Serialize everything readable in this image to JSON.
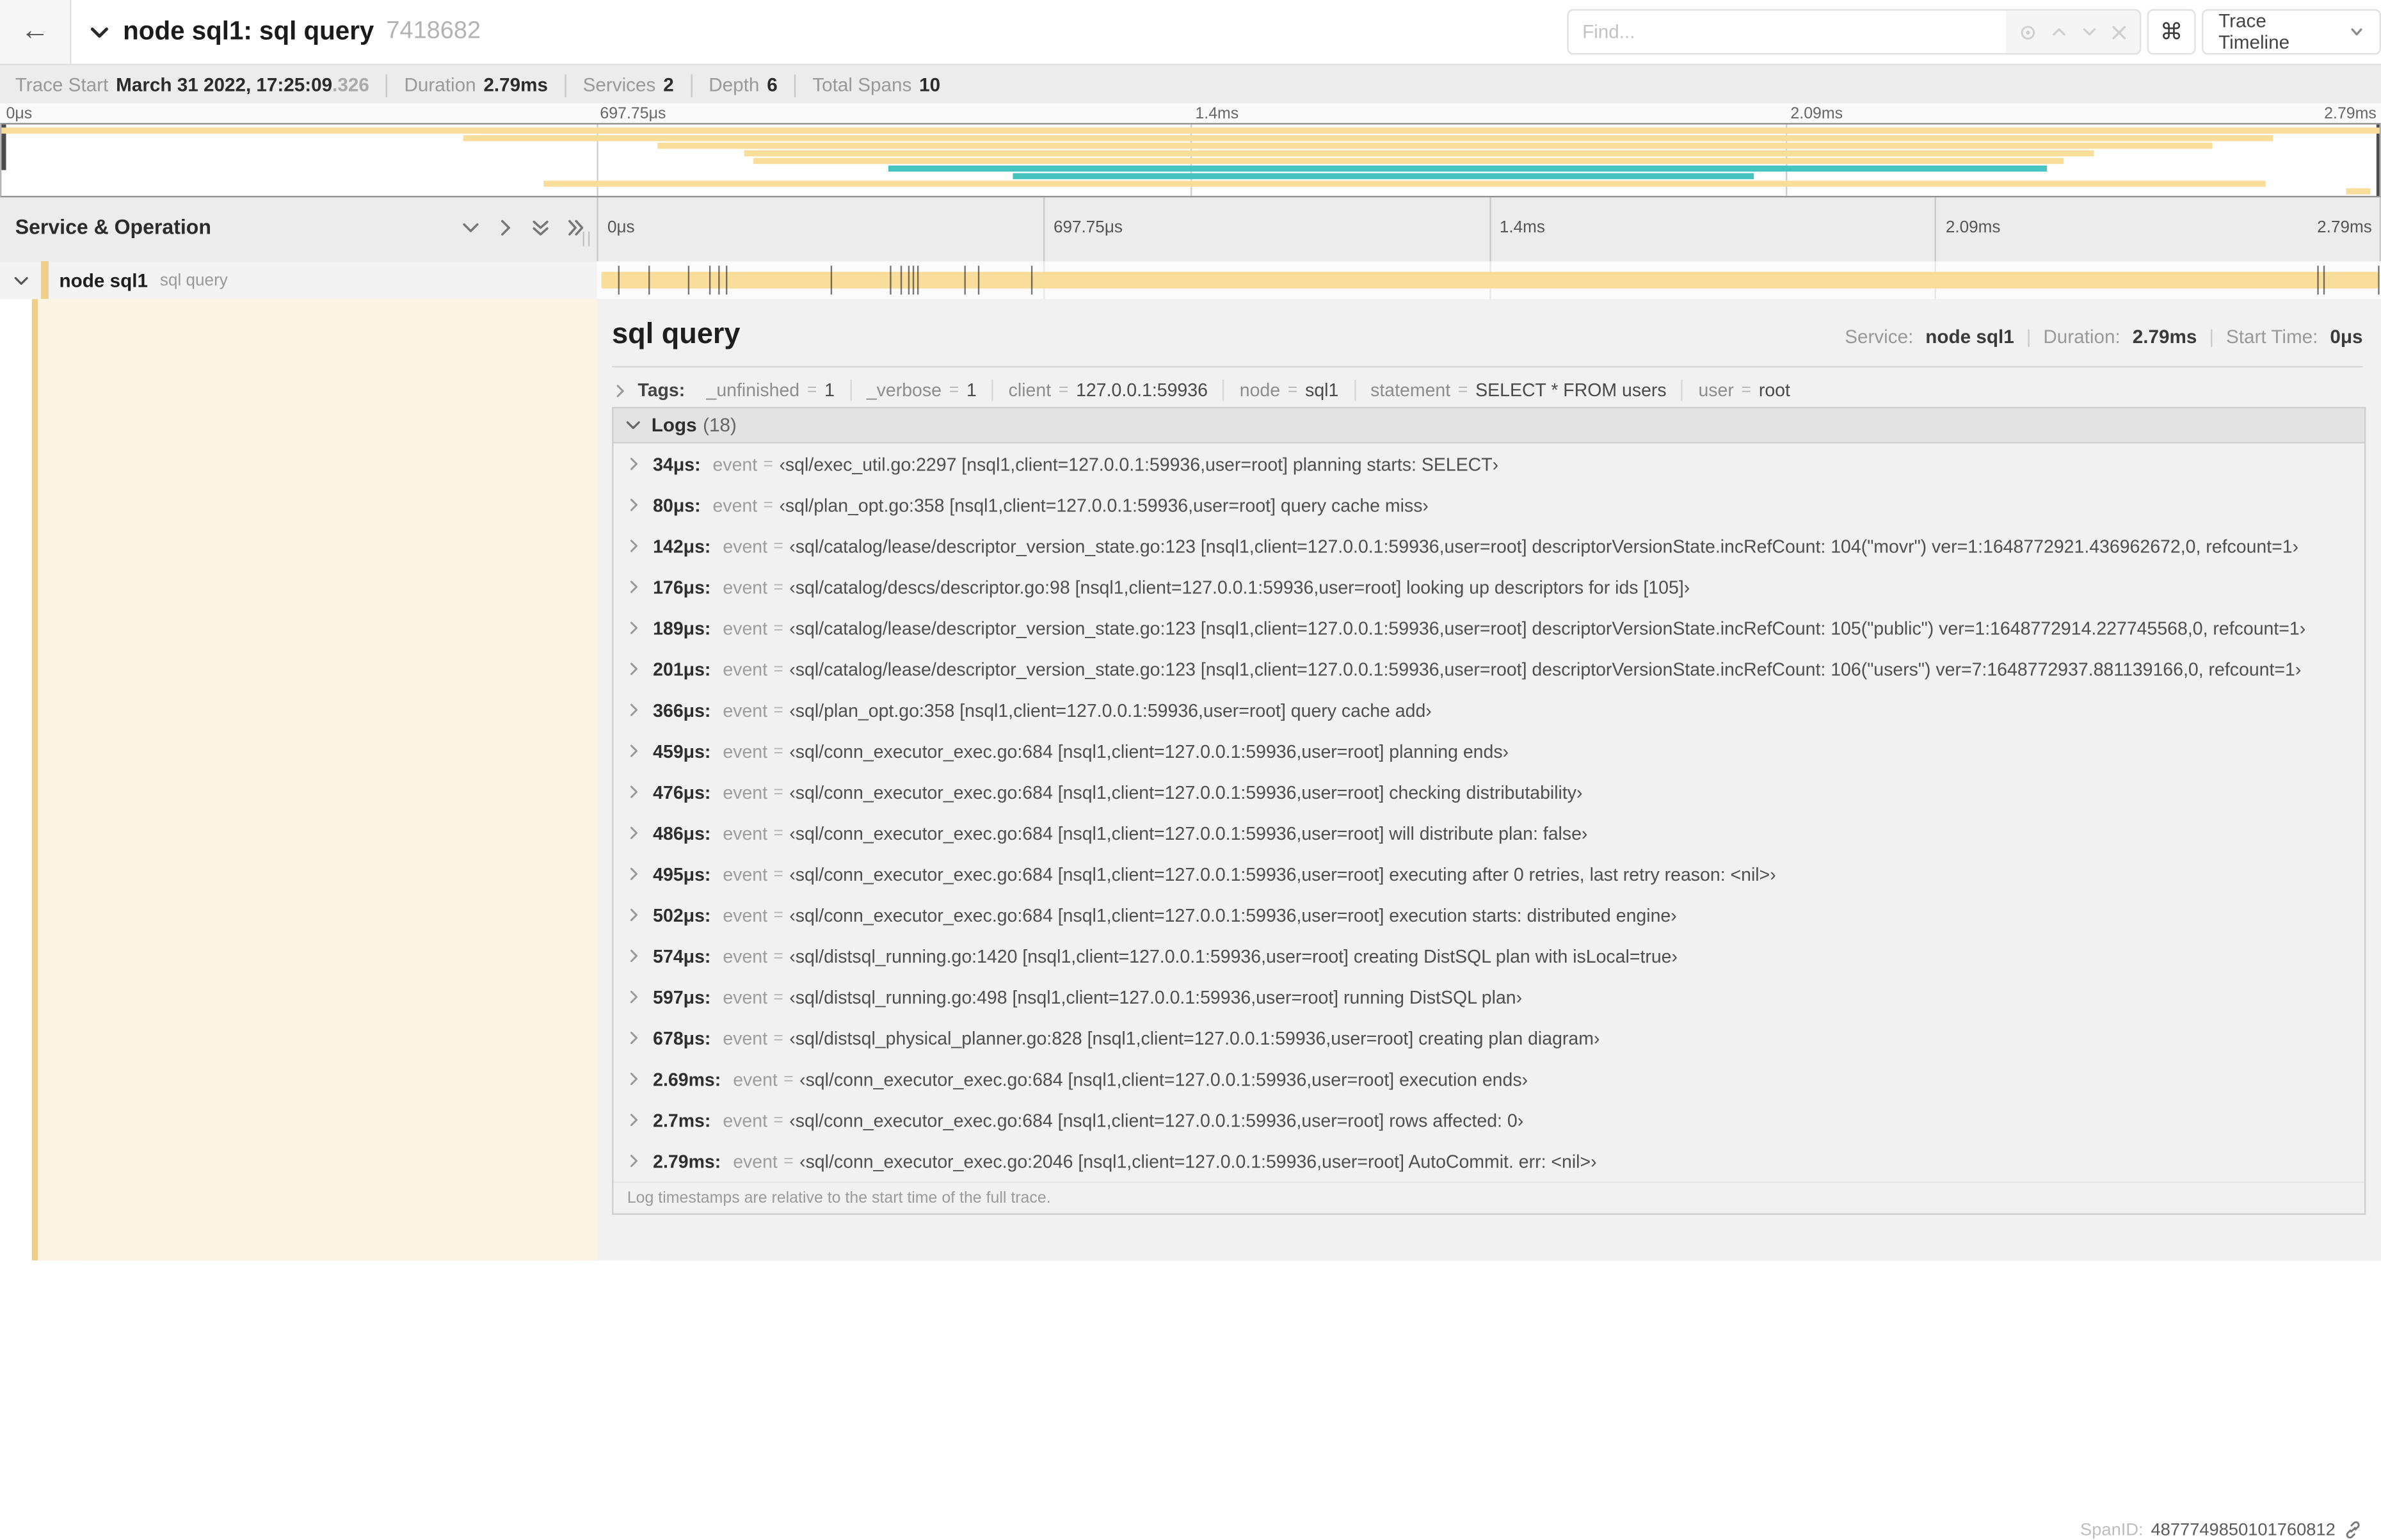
{
  "colors": {
    "orange": "#F8DD9B",
    "teal": "#47C4C0",
    "strip": "#F0CE8B",
    "cream": "#FCF4E3"
  },
  "header": {
    "title": "node sql1: sql query",
    "trace_id": "7418682",
    "find_placeholder": "Find...",
    "shortcut_key": "⌘",
    "view_selector": "Trace Timeline"
  },
  "summary": {
    "items": [
      {
        "label": "Trace Start",
        "value": "March 31 2022, 17:25:09",
        "suffix": ".326"
      },
      {
        "label": "Duration",
        "value": "2.79ms",
        "suffix": ""
      },
      {
        "label": "Services",
        "value": "2",
        "suffix": ""
      },
      {
        "label": "Depth",
        "value": "6",
        "suffix": ""
      },
      {
        "label": "Total Spans",
        "value": "10",
        "suffix": ""
      }
    ]
  },
  "ticks": [
    "0μs",
    "697.75μs",
    "1.4ms",
    "2.09ms",
    "2.79ms"
  ],
  "minimap": {
    "bars": [
      {
        "left": 0,
        "width": 100,
        "color": "orange"
      },
      {
        "left": 19.4,
        "width": 76.1,
        "color": "orange"
      },
      {
        "left": 27.6,
        "width": 65.4,
        "color": "orange"
      },
      {
        "left": 31.2,
        "width": 56.8,
        "color": "orange"
      },
      {
        "left": 31.6,
        "width": 55.1,
        "color": "orange"
      },
      {
        "left": 37.3,
        "width": 48.7,
        "color": "teal"
      },
      {
        "left": 42.5,
        "width": 31.2,
        "color": "teal"
      },
      {
        "left": 22.8,
        "width": 72.4,
        "color": "orange"
      },
      {
        "left": 98.6,
        "width": 1.0,
        "color": "orange"
      }
    ]
  },
  "timeline": {
    "column_header": "Service & Operation",
    "resizer_glyph": "||",
    "row": {
      "service": "node sql1",
      "operation": "sql query"
    },
    "markers_pct": [
      1.22,
      2.87,
      5.09,
      6.31,
      6.77,
      7.2,
      13.12,
      16.45,
      17.06,
      17.42,
      17.74,
      17.99,
      20.57,
      21.4,
      24.3,
      96.42,
      96.77,
      99.8
    ]
  },
  "detail": {
    "title": "sql query",
    "service_label": "Service:",
    "service": "node sql1",
    "duration_label": "Duration:",
    "duration": "2.79ms",
    "start_label": "Start Time:",
    "start": "0μs",
    "sep": "|",
    "tags": {
      "label": "Tags:",
      "eq": "=",
      "items": [
        {
          "key": "_unfinished",
          "value": "1"
        },
        {
          "key": "_verbose",
          "value": "1"
        },
        {
          "key": "client",
          "value": "127.0.0.1:59936"
        },
        {
          "key": "node",
          "value": "sql1"
        },
        {
          "key": "statement",
          "value": "SELECT * FROM users"
        },
        {
          "key": "user",
          "value": "root"
        }
      ]
    },
    "logs": {
      "label": "Logs",
      "count": "(18)",
      "eq": "=",
      "key": "event",
      "rows": [
        {
          "time": "34μs:",
          "value": "‹sql/exec_util.go:2297 [nsql1,client=127.0.0.1:59936,user=root] planning starts: SELECT›"
        },
        {
          "time": "80μs:",
          "value": "‹sql/plan_opt.go:358 [nsql1,client=127.0.0.1:59936,user=root] query cache miss›"
        },
        {
          "time": "142μs:",
          "value": "‹sql/catalog/lease/descriptor_version_state.go:123 [nsql1,client=127.0.0.1:59936,user=root] descriptorVersionState.incRefCount: 104(\"movr\") ver=1:1648772921.436962672,0, refcount=1›"
        },
        {
          "time": "176μs:",
          "value": "‹sql/catalog/descs/descriptor.go:98 [nsql1,client=127.0.0.1:59936,user=root] looking up descriptors for ids [105]›"
        },
        {
          "time": "189μs:",
          "value": "‹sql/catalog/lease/descriptor_version_state.go:123 [nsql1,client=127.0.0.1:59936,user=root] descriptorVersionState.incRefCount: 105(\"public\") ver=1:1648772914.227745568,0, refcount=1›"
        },
        {
          "time": "201μs:",
          "value": "‹sql/catalog/lease/descriptor_version_state.go:123 [nsql1,client=127.0.0.1:59936,user=root] descriptorVersionState.incRefCount: 106(\"users\") ver=7:1648772937.881139166,0, refcount=1›"
        },
        {
          "time": "366μs:",
          "value": "‹sql/plan_opt.go:358 [nsql1,client=127.0.0.1:59936,user=root] query cache add›"
        },
        {
          "time": "459μs:",
          "value": "‹sql/conn_executor_exec.go:684 [nsql1,client=127.0.0.1:59936,user=root] planning ends›"
        },
        {
          "time": "476μs:",
          "value": "‹sql/conn_executor_exec.go:684 [nsql1,client=127.0.0.1:59936,user=root] checking distributability›"
        },
        {
          "time": "486μs:",
          "value": "‹sql/conn_executor_exec.go:684 [nsql1,client=127.0.0.1:59936,user=root] will distribute plan: false›"
        },
        {
          "time": "495μs:",
          "value": "‹sql/conn_executor_exec.go:684 [nsql1,client=127.0.0.1:59936,user=root] executing after 0 retries, last retry reason: <nil>›"
        },
        {
          "time": "502μs:",
          "value": "‹sql/conn_executor_exec.go:684 [nsql1,client=127.0.0.1:59936,user=root] execution starts: distributed engine›"
        },
        {
          "time": "574μs:",
          "value": "‹sql/distsql_running.go:1420 [nsql1,client=127.0.0.1:59936,user=root] creating DistSQL plan with isLocal=true›"
        },
        {
          "time": "597μs:",
          "value": "‹sql/distsql_running.go:498 [nsql1,client=127.0.0.1:59936,user=root] running DistSQL plan›"
        },
        {
          "time": "678μs:",
          "value": "‹sql/distsql_physical_planner.go:828 [nsql1,client=127.0.0.1:59936,user=root] creating plan diagram›"
        },
        {
          "time": "2.69ms:",
          "value": "‹sql/conn_executor_exec.go:684 [nsql1,client=127.0.0.1:59936,user=root] execution ends›"
        },
        {
          "time": "2.7ms:",
          "value": "‹sql/conn_executor_exec.go:684 [nsql1,client=127.0.0.1:59936,user=root] rows affected: 0›"
        },
        {
          "time": "2.79ms:",
          "value": "‹sql/conn_executor_exec.go:2046 [nsql1,client=127.0.0.1:59936,user=root] AutoCommit. err: <nil>›"
        }
      ],
      "footer": "Log timestamps are relative to the start time of the full trace."
    },
    "span_id_label": "SpanID:",
    "span_id": "4877749850101760812"
  }
}
